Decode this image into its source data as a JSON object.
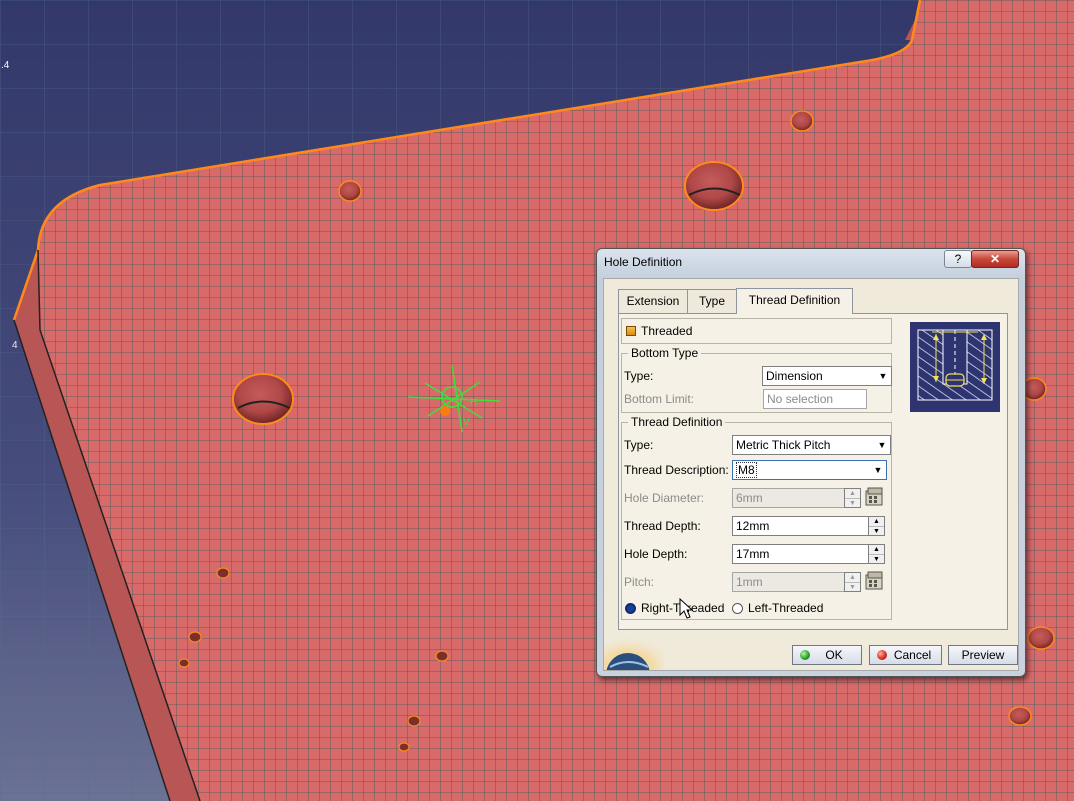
{
  "viewport": {
    "axis_label": ".4",
    "side_mark": "4",
    "colors": {
      "background": "#3d4272",
      "part": "#d96a6a",
      "edge": "#ff8a1a",
      "grid": "#3a5a52",
      "hole_shadow": "#7a2e2e"
    }
  },
  "dialog": {
    "title": "Hole Definition",
    "help_label": "?",
    "close_label": "✕",
    "tabs": [
      {
        "label": "Extension"
      },
      {
        "label": "Type"
      },
      {
        "label": "Thread Definition"
      }
    ],
    "threaded": {
      "label": "Threaded",
      "checked": true
    },
    "bottom_type": {
      "legend": "Bottom Type",
      "type_label": "Type:",
      "type_value": "Dimension",
      "limit_label": "Bottom Limit:",
      "limit_value": "No selection"
    },
    "thread_def": {
      "legend": "Thread Definition",
      "type_label": "Type:",
      "type_value": "Metric Thick Pitch",
      "desc_label": "Thread Description:",
      "desc_value": "M8",
      "hole_diameter_label": "Hole Diameter:",
      "hole_diameter_value": "6mm",
      "thread_depth_label": "Thread Depth:",
      "thread_depth_value": "12mm",
      "hole_depth_label": "Hole Depth:",
      "hole_depth_value": "17mm",
      "pitch_label": "Pitch:",
      "pitch_value": "1mm",
      "right_label": "Right-Threaded",
      "left_label": "Left-Threaded",
      "selected": "Right-Threaded"
    },
    "buttons": {
      "ok": "OK",
      "cancel": "Cancel",
      "preview": "Preview"
    },
    "icons": {
      "formula": "formula-icon",
      "spinner": "spinner-icon",
      "thread_preview": "thread-diagram-icon",
      "catia_logo": "catia-logo-icon"
    }
  }
}
